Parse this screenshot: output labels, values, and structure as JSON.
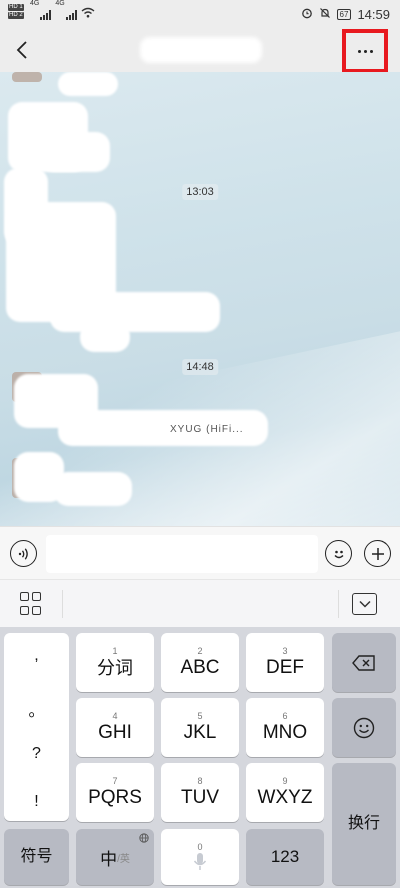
{
  "status_bar": {
    "sim1": "HD 1",
    "sim2": "HD 2",
    "network": "4G",
    "network2": "4G",
    "battery": "67",
    "time": "14:59"
  },
  "title_bar": {
    "back_icon": "chevron-left-icon",
    "more_icon": "more-dots-icon",
    "highlight_color": "#e8191f"
  },
  "chat": {
    "timestamps": [
      "13:03",
      "14:48"
    ],
    "partial_text": "XYUG (HiFi..."
  },
  "input_bar": {
    "voice_icon": "voice-icon",
    "emoji_icon": "emoji-icon",
    "plus_icon": "plus-icon",
    "message_value": ""
  },
  "keyboard_toolbar": {
    "menu_icon": "grid-menu-icon",
    "hide_icon": "keyboard-hide-icon"
  },
  "keyboard": {
    "punctuation": [
      ",",
      "。",
      "?",
      "!"
    ],
    "keys": [
      {
        "sub": "1",
        "main": "分词"
      },
      {
        "sub": "2",
        "main": "ABC"
      },
      {
        "sub": "3",
        "main": "DEF"
      },
      {
        "sub": "4",
        "main": "GHI"
      },
      {
        "sub": "5",
        "main": "JKL"
      },
      {
        "sub": "6",
        "main": "MNO"
      },
      {
        "sub": "7",
        "main": "PQRS"
      },
      {
        "sub": "8",
        "main": "TUV"
      },
      {
        "sub": "9",
        "main": "WXYZ"
      }
    ],
    "symbols_label": "符号",
    "lang_zh": "中",
    "lang_en": "/英",
    "space_sub": "0",
    "num_label": "123",
    "enter_label": "换行",
    "backspace_icon": "backspace-icon",
    "emoji_key_icon": "emoji-icon"
  }
}
